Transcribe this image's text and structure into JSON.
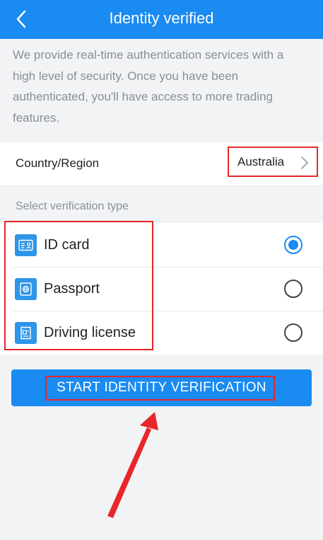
{
  "header": {
    "title": "Identity verified",
    "back_icon": "chevron-left-icon",
    "background": "#1a8bf0"
  },
  "intro": {
    "text": "We provide real-time authentication services with a high level of security. Once you have been authenticated, you'll have access to more trading features."
  },
  "country": {
    "label": "Country/Region",
    "value": "Australia",
    "chevron_icon": "chevron-right-icon"
  },
  "verification": {
    "section_label": "Select verification type",
    "options": [
      {
        "label": "ID card",
        "icon": "id-card-icon",
        "selected": true
      },
      {
        "label": "Passport",
        "icon": "passport-icon",
        "selected": false
      },
      {
        "label": "Driving license",
        "icon": "driving-license-icon",
        "selected": false
      }
    ]
  },
  "start_button": {
    "label": "START IDENTITY VERIFICATION"
  },
  "annotation": {
    "highlight_color": "#e8262a",
    "arrow_icon": "red-arrow-icon"
  }
}
